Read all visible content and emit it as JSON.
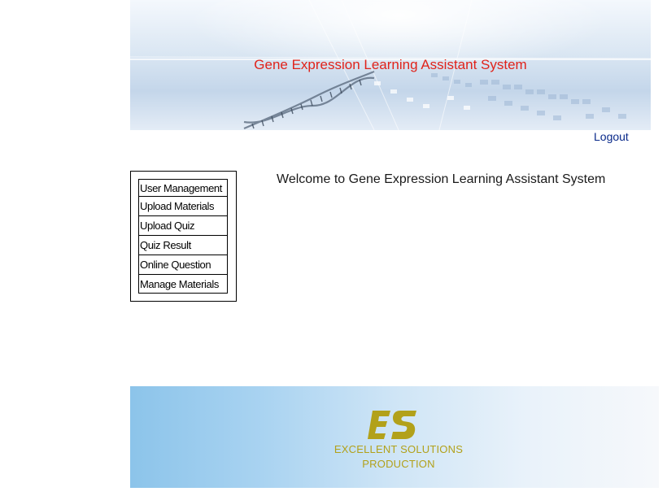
{
  "header": {
    "title": "Gene Expression Learning Assistant System",
    "title_color": "#e0231b"
  },
  "logout_label": "Logout",
  "menu": {
    "items": [
      {
        "label": "User Management"
      },
      {
        "label": "Upload Materials"
      },
      {
        "label": "Upload Quiz"
      },
      {
        "label": "Quiz Result"
      },
      {
        "label": "Online Question"
      },
      {
        "label": "Manage Materials"
      }
    ]
  },
  "welcome": "Welcome to Gene Expression Learning Assistant System",
  "footer": {
    "logo_letters": "ES",
    "line1": "EXCELLENT SOLUTIONS",
    "line2": "PRODUCTION",
    "logo_color": "#b2a11a"
  }
}
